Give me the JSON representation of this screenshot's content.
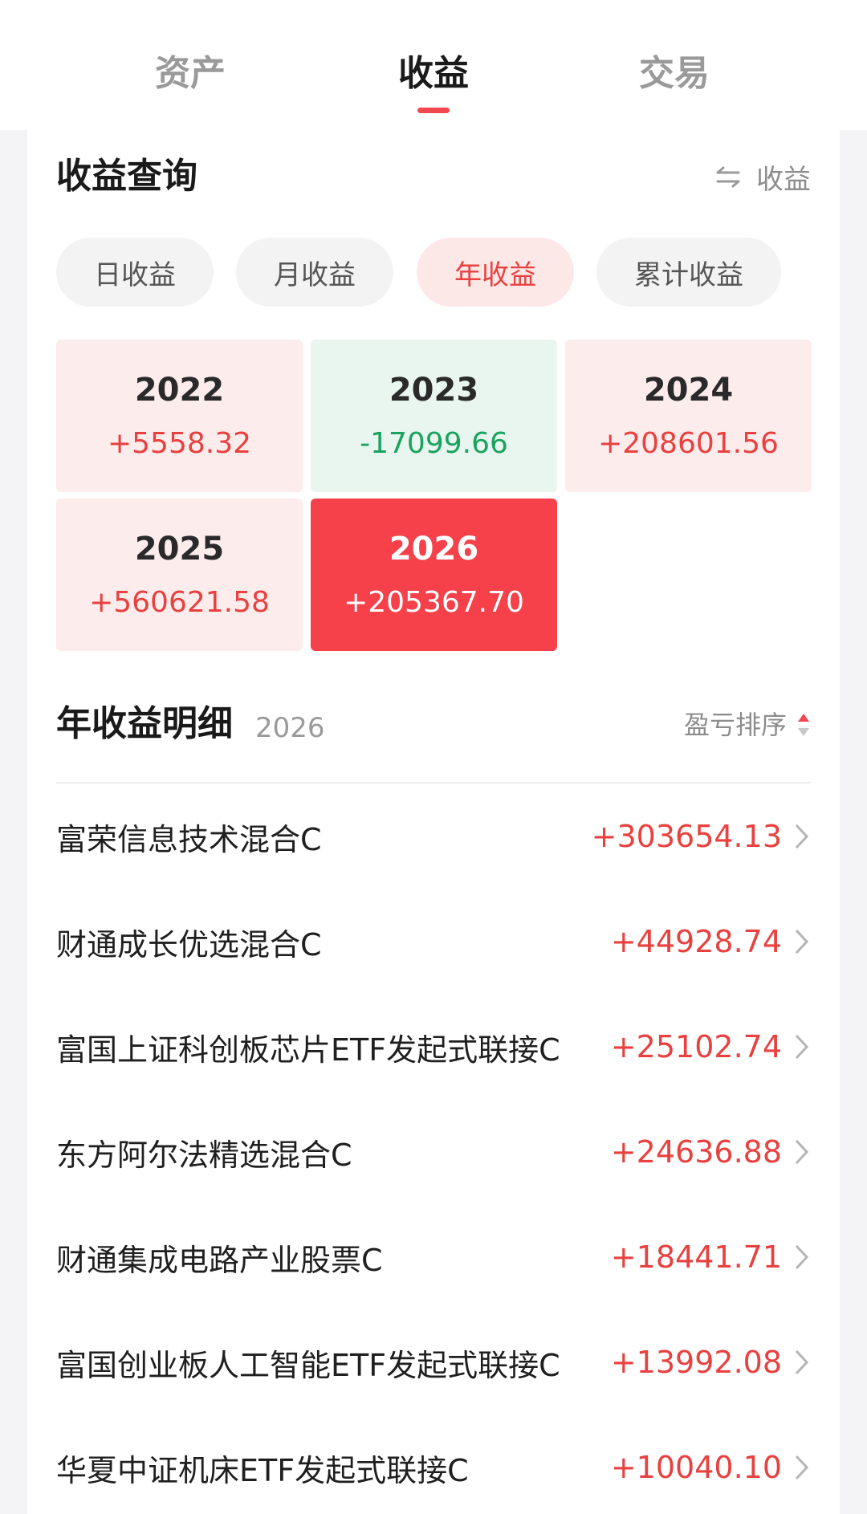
{
  "tabs": [
    {
      "label": "资产"
    },
    {
      "label": "收益"
    },
    {
      "label": "交易"
    }
  ],
  "query": {
    "title": "收益查询",
    "switch_label": "收益"
  },
  "period_pills": [
    {
      "label": "日收益"
    },
    {
      "label": "月收益"
    },
    {
      "label": "年收益"
    },
    {
      "label": "累计收益"
    }
  ],
  "years": [
    {
      "year": "2022",
      "value": "+5558.32"
    },
    {
      "year": "2023",
      "value": "-17099.66"
    },
    {
      "year": "2024",
      "value": "+208601.56"
    },
    {
      "year": "2025",
      "value": "+560621.58"
    },
    {
      "year": "2026",
      "value": "+205367.70"
    }
  ],
  "detail": {
    "title": "年收益明细",
    "year": "2026",
    "sort_label": "盈亏排序"
  },
  "funds": [
    {
      "name": "富荣信息技术混合C",
      "value": "+303654.13"
    },
    {
      "name": "财通成长优选混合C",
      "value": "+44928.74"
    },
    {
      "name": "富国上证科创板芯片ETF发起式联接C",
      "value": "+25102.74"
    },
    {
      "name": "东方阿尔法精选混合C",
      "value": "+24636.88"
    },
    {
      "name": "财通集成电路产业股票C",
      "value": "+18441.71"
    },
    {
      "name": "富国创业板人工智能ETF发起式联接C",
      "value": "+13992.08"
    },
    {
      "name": "华夏中证机床ETF发起式联接C",
      "value": "+10040.10"
    }
  ],
  "colors": {
    "accent": "#f0484e",
    "profit": "#e8413f",
    "loss": "#19a35f",
    "selected_bg": "#f6414a"
  }
}
